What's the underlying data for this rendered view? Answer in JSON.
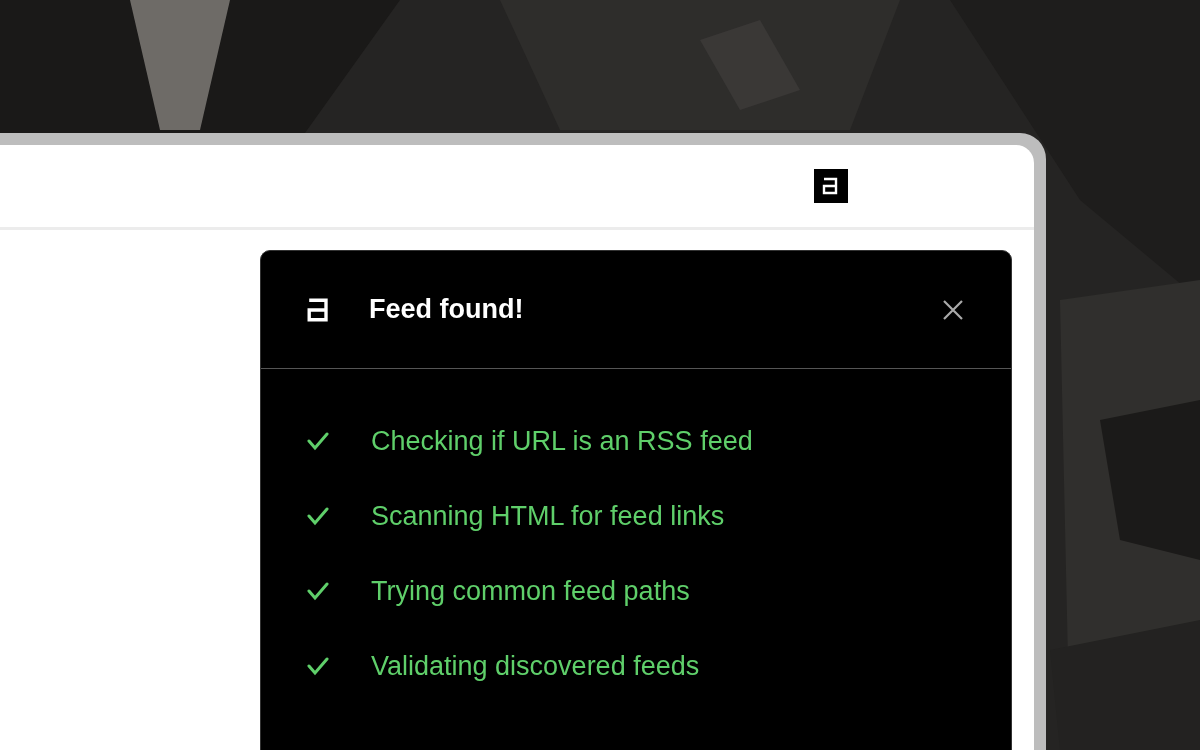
{
  "popup": {
    "title": "Feed found!",
    "steps": [
      {
        "label": "Checking if URL is an RSS feed",
        "done": true
      },
      {
        "label": "Scanning HTML for feed links",
        "done": true
      },
      {
        "label": "Trying common feed paths",
        "done": true
      },
      {
        "label": "Validating discovered feeds",
        "done": true
      }
    ]
  }
}
